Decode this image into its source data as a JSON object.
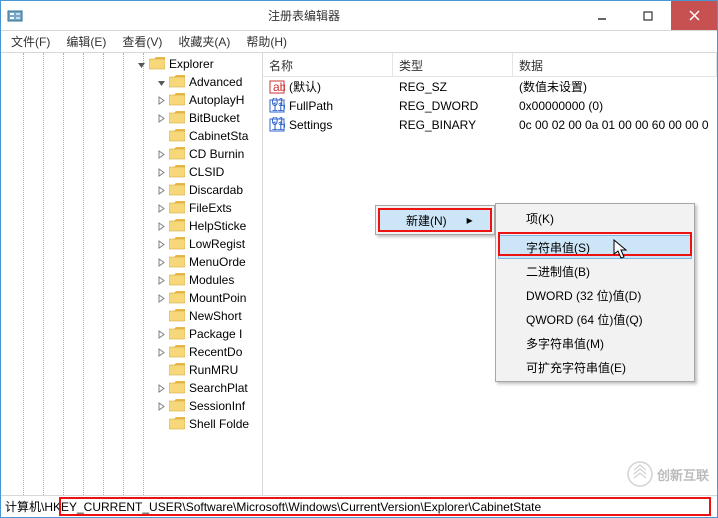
{
  "title": "注册表编辑器",
  "menubar": [
    "文件(F)",
    "编辑(E)",
    "查看(V)",
    "收藏夹(A)",
    "帮助(H)"
  ],
  "tree": {
    "root": "Explorer",
    "items": [
      {
        "label": "Advanced",
        "expander": "open",
        "indent": 3
      },
      {
        "label": "AutoplayH",
        "expander": "closed",
        "indent": 3
      },
      {
        "label": "BitBucket",
        "expander": "closed",
        "indent": 3
      },
      {
        "label": "CabinetSta",
        "expander": "none",
        "indent": 3
      },
      {
        "label": "CD Burnin",
        "expander": "closed",
        "indent": 3
      },
      {
        "label": "CLSID",
        "expander": "closed",
        "indent": 3
      },
      {
        "label": "Discardab",
        "expander": "closed",
        "indent": 3
      },
      {
        "label": "FileExts",
        "expander": "closed",
        "indent": 3
      },
      {
        "label": "HelpSticke",
        "expander": "closed",
        "indent": 3
      },
      {
        "label": "LowRegist",
        "expander": "closed",
        "indent": 3
      },
      {
        "label": "MenuOrde",
        "expander": "closed",
        "indent": 3
      },
      {
        "label": "Modules",
        "expander": "closed",
        "indent": 3
      },
      {
        "label": "MountPoin",
        "expander": "closed",
        "indent": 3
      },
      {
        "label": "NewShort",
        "expander": "none",
        "indent": 3
      },
      {
        "label": "Package I",
        "expander": "closed",
        "indent": 3
      },
      {
        "label": "RecentDo",
        "expander": "closed",
        "indent": 3
      },
      {
        "label": "RunMRU",
        "expander": "none",
        "indent": 3
      },
      {
        "label": "SearchPlat",
        "expander": "closed",
        "indent": 3
      },
      {
        "label": "SessionInf",
        "expander": "closed",
        "indent": 3
      },
      {
        "label": "Shell Folde",
        "expander": "none",
        "indent": 3
      }
    ]
  },
  "list": {
    "headers": {
      "name": "名称",
      "type": "类型",
      "data": "数据"
    },
    "rows": [
      {
        "icon": "string",
        "name": "(默认)",
        "type": "REG_SZ",
        "data": "(数值未设置)"
      },
      {
        "icon": "binary",
        "name": "FullPath",
        "type": "REG_DWORD",
        "data": "0x00000000 (0)"
      },
      {
        "icon": "binary",
        "name": "Settings",
        "type": "REG_BINARY",
        "data": "0c 00 02 00 0a 01 00 00 60 00 00 0"
      }
    ]
  },
  "context_menu": {
    "parent": {
      "label": "新建(N)"
    },
    "items": [
      {
        "label": "项(K)"
      },
      {
        "label": "字符串值(S)",
        "hover": true
      },
      {
        "label": "二进制值(B)"
      },
      {
        "label": "DWORD (32 位)值(D)"
      },
      {
        "label": "QWORD (64 位)值(Q)"
      },
      {
        "label": "多字符串值(M)"
      },
      {
        "label": "可扩充字符串值(E)"
      }
    ]
  },
  "statusbar": {
    "path": "计算机\\HKEY_CURRENT_USER\\Software\\Microsoft\\Windows\\CurrentVersion\\Explorer\\CabinetState"
  },
  "watermark": {
    "text": "创新互联"
  }
}
